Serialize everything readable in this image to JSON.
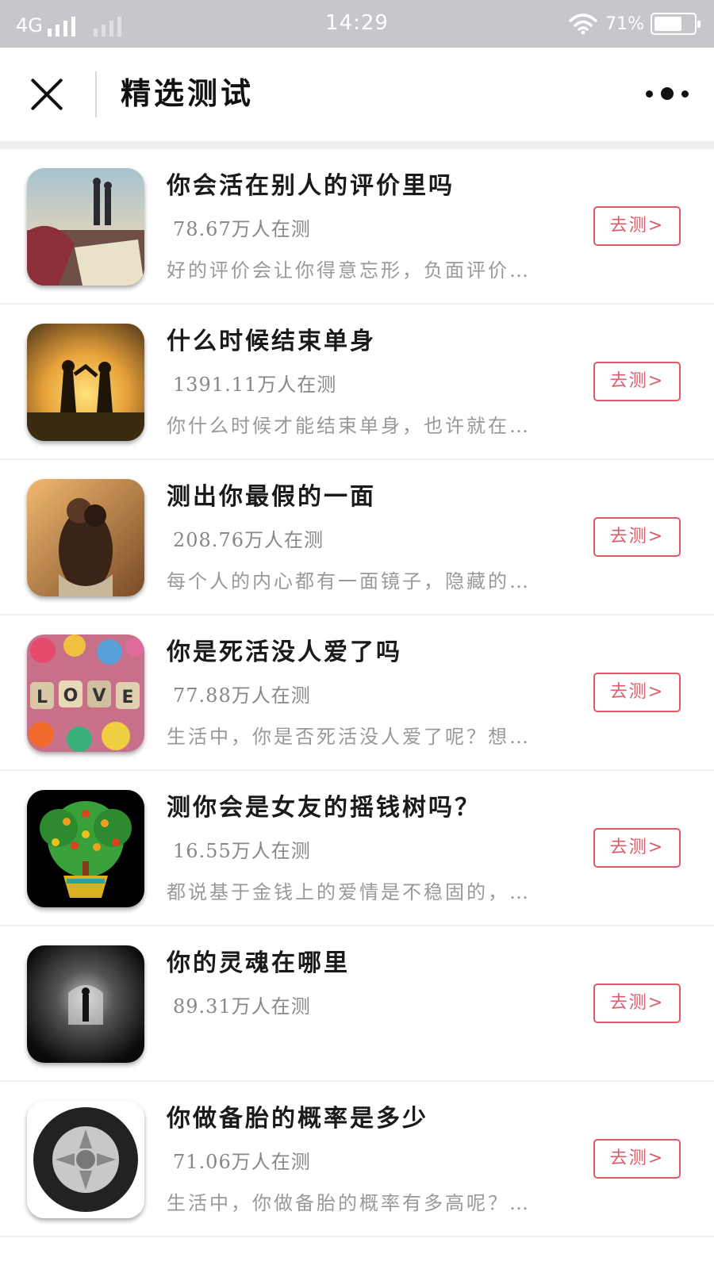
{
  "status_bar": {
    "network": "4G",
    "time": "14:29",
    "battery_percent": "71%",
    "battery_level": 0.71,
    "icons": [
      "signal-bars-icon",
      "wifi-icon",
      "battery-icon"
    ]
  },
  "navbar": {
    "title": "精选测试",
    "close_icon": "close-icon",
    "more_icon": "more-dots-icon"
  },
  "colors": {
    "accent": "#e05a6a",
    "status_bar_bg": "#c7c6cb",
    "separator": "#f0eff4"
  },
  "items": [
    {
      "title": "你会活在别人的评价里吗",
      "count": "78.67万人在测",
      "desc": "好的评价会让你得意忘形，负面评价…",
      "button": "去测>"
    },
    {
      "title": "什么时候结束单身",
      "count": "1391.11万人在测",
      "desc": "你什么时候才能结束单身，也许就在…",
      "button": "去测>"
    },
    {
      "title": "测出你最假的一面",
      "count": "208.76万人在测",
      "desc": "每个人的内心都有一面镜子，隐藏的…",
      "button": "去测>"
    },
    {
      "title": "你是死活没人爱了吗",
      "count": "77.88万人在测",
      "desc": "生活中，你是否死活没人爱了呢？想…",
      "button": "去测>"
    },
    {
      "title": "测你会是女友的摇钱树吗？",
      "count": "16.55万人在测",
      "desc": "都说基于金钱上的爱情是不稳固的，…",
      "button": "去测>"
    },
    {
      "title": "你的灵魂在哪里",
      "count": "89.31万人在测",
      "desc": "",
      "button": "去测>"
    },
    {
      "title": "你做备胎的概率是多少",
      "count": "71.06万人在测",
      "desc": "生活中，你做备胎的概率有多高呢？…",
      "button": "去测>"
    }
  ]
}
